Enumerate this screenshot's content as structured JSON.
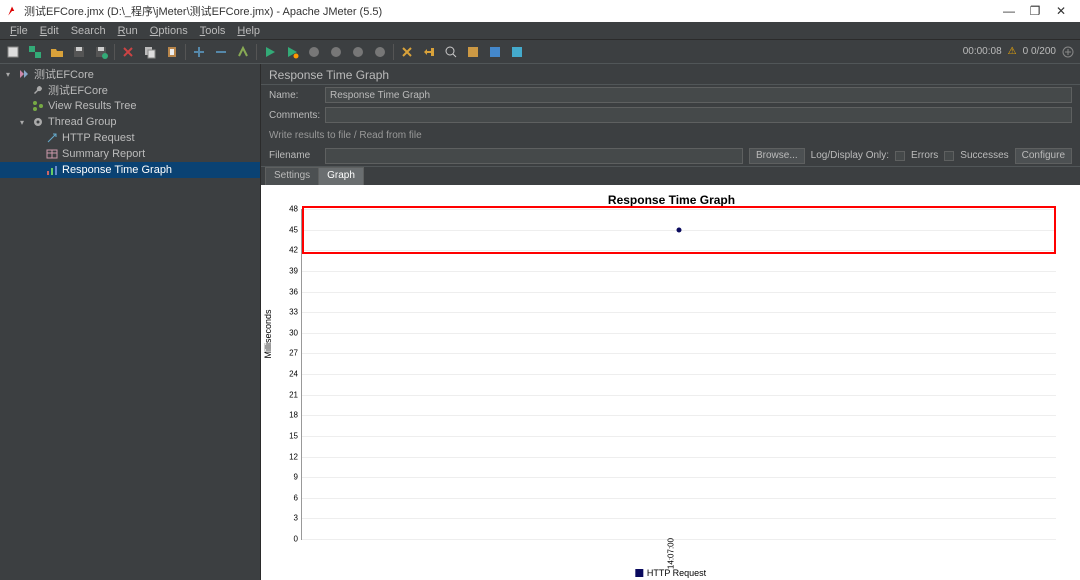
{
  "window": {
    "title": "测试EFCore.jmx (D:\\_程序\\jMeter\\测试EFCore.jmx) - Apache JMeter (5.5)"
  },
  "menu": [
    "File",
    "Edit",
    "Search",
    "Run",
    "Options",
    "Tools",
    "Help"
  ],
  "toolbar_status": {
    "elapsed": "00:00:08",
    "warn_icon": "⚠",
    "count": "0  0/200"
  },
  "tree": [
    {
      "depth": 0,
      "tw": "▾",
      "icon": "plan",
      "label": "测试EFCore"
    },
    {
      "depth": 1,
      "tw": "",
      "icon": "wrench",
      "label": "测试EFCore"
    },
    {
      "depth": 1,
      "tw": "",
      "icon": "tree",
      "label": "View Results Tree"
    },
    {
      "depth": 1,
      "tw": "▾",
      "icon": "gear",
      "label": "Thread Group"
    },
    {
      "depth": 2,
      "tw": "",
      "icon": "http",
      "label": "HTTP Request"
    },
    {
      "depth": 2,
      "tw": "",
      "icon": "table",
      "label": "Summary Report"
    },
    {
      "depth": 2,
      "tw": "",
      "icon": "chart",
      "label": "Response Time Graph",
      "sel": true
    }
  ],
  "panel": {
    "heading": "Response Time Graph",
    "name_label": "Name:",
    "name_value": "Response Time Graph",
    "comments_label": "Comments:",
    "write_hint": "Write results to file / Read from file",
    "filename_label": "Filename",
    "browse": "Browse...",
    "logdisplay": "Log/Display Only:",
    "errors_cb": "Errors",
    "successes_cb": "Successes",
    "configure": "Configure"
  },
  "tabs": [
    "Settings",
    "Graph"
  ],
  "active_tab": "Graph",
  "chart_data": {
    "type": "line",
    "title": "Response Time Graph",
    "ylabel": "Milliseconds",
    "ylim": [
      0,
      48
    ],
    "yticks": [
      0,
      3,
      6,
      9,
      12,
      15,
      18,
      21,
      24,
      27,
      30,
      33,
      36,
      39,
      42,
      45,
      48
    ],
    "xticks": [
      "14:07:00"
    ],
    "series": [
      {
        "name": "HTTP Request",
        "color": "#0a0a5e",
        "x": [
          "14:07:00"
        ],
        "y": [
          45
        ]
      }
    ],
    "highlight_box_y_range": [
      42,
      48
    ]
  },
  "legend": "HTTP Request"
}
